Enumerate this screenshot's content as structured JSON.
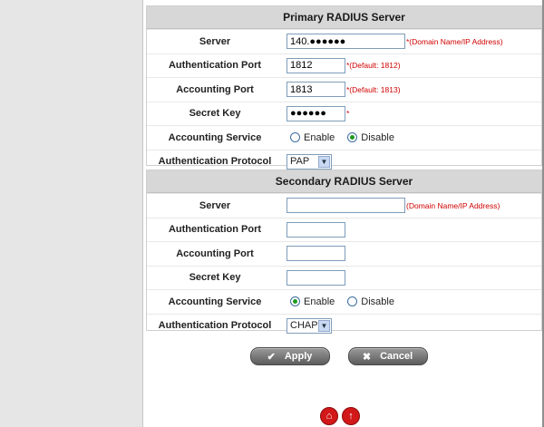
{
  "primary": {
    "title": "Primary RADIUS Server",
    "server": {
      "label": "Server",
      "value": "140.●●●●●●",
      "hint": "*(Domain Name/IP Address)"
    },
    "auth_port": {
      "label": "Authentication Port",
      "value": "1812",
      "hint": "*(Default: 1812)"
    },
    "acct_port": {
      "label": "Accounting Port",
      "value": "1813",
      "hint": "*(Default: 1813)"
    },
    "secret": {
      "label": "Secret Key",
      "value": "●●●●●●",
      "hint": "*"
    },
    "acct_service": {
      "label": "Accounting Service",
      "enable": "Enable",
      "disable": "Disable",
      "selected": "Disable"
    },
    "protocol": {
      "label": "Authentication Protocol",
      "value": "PAP"
    }
  },
  "secondary": {
    "title": "Secondary RADIUS Server",
    "server": {
      "label": "Server",
      "value": "",
      "hint": "(Domain Name/IP Address)"
    },
    "auth_port": {
      "label": "Authentication Port",
      "value": ""
    },
    "acct_port": {
      "label": "Accounting Port",
      "value": ""
    },
    "secret": {
      "label": "Secret Key",
      "value": ""
    },
    "acct_service": {
      "label": "Accounting Service",
      "enable": "Enable",
      "disable": "Disable",
      "selected": "Enable"
    },
    "protocol": {
      "label": "Authentication Protocol",
      "value": "CHAP"
    }
  },
  "actions": {
    "apply": "Apply",
    "cancel": "Cancel"
  },
  "icons": {
    "home": "home-icon",
    "up": "up-arrow-icon"
  },
  "colors": {
    "header_bg": "#d7d7d7",
    "hint": "#d00000",
    "radio_dot": "#1f9a1f",
    "nav_icon": "#d21818"
  }
}
